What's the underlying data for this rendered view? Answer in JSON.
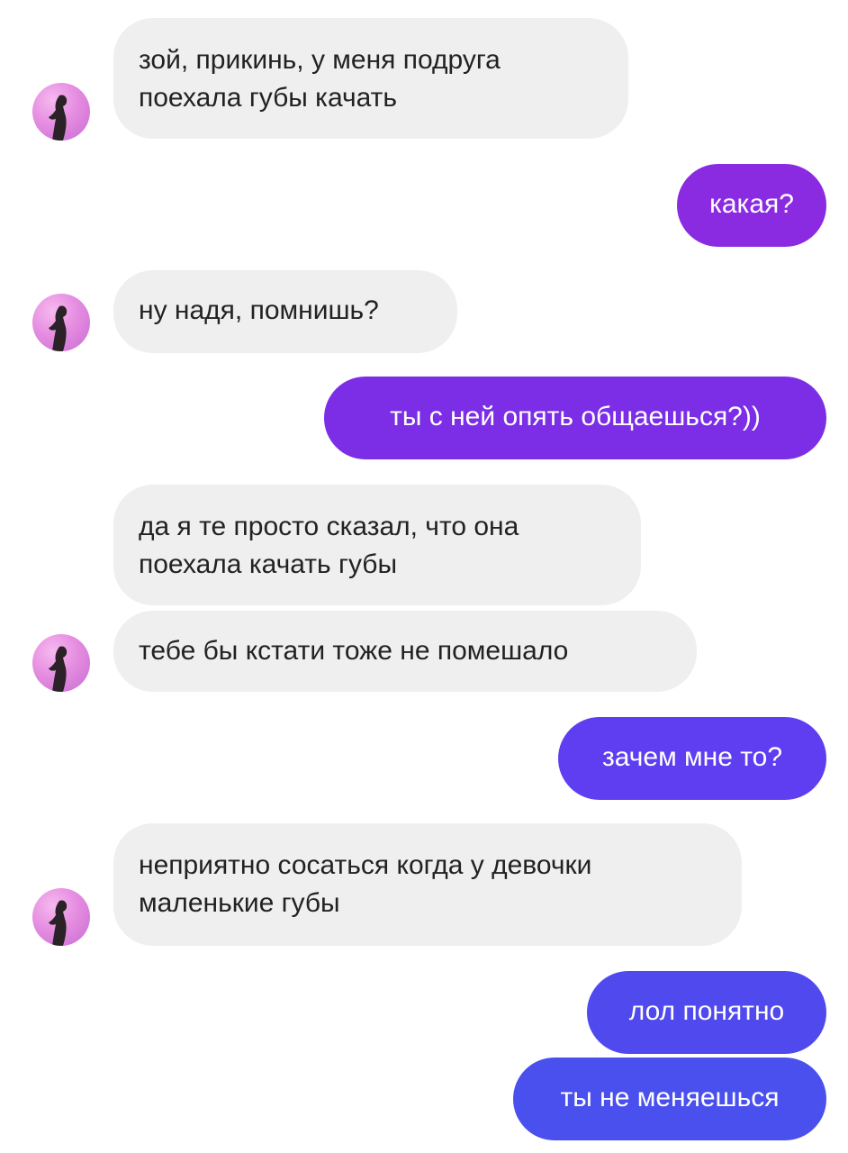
{
  "conversation": {
    "messages": [
      {
        "sender": "contact",
        "lines": [
          "зой, прикинь, у меня подруга",
          "поехала губы качать"
        ]
      },
      {
        "sender": "me",
        "text": "какая?",
        "color": "#8a2be2"
      },
      {
        "sender": "contact",
        "lines": [
          "ну надя, помнишь?"
        ]
      },
      {
        "sender": "me",
        "text": "ты с ней опять общаешься?))",
        "color": "#7b2ee6"
      },
      {
        "sender": "contact",
        "lines": [
          "да я те просто сказал, что она",
          "поехала качать губы"
        ]
      },
      {
        "sender": "contact",
        "lines": [
          "тебе бы кстати тоже не помешало"
        ]
      },
      {
        "sender": "me",
        "text": "зачем мне то?",
        "color": "#5e3ef0"
      },
      {
        "sender": "contact",
        "lines": [
          "неприятно сосаться когда у девочки",
          "маленькие губы"
        ]
      },
      {
        "sender": "me",
        "text": "лол понятно",
        "color": "#4f49ee"
      },
      {
        "sender": "me",
        "text": "ты не меняешься",
        "color": "#4a50ee"
      }
    ]
  },
  "avatar": {
    "icon": "contact-avatar-icon",
    "color": "#e58de0"
  }
}
